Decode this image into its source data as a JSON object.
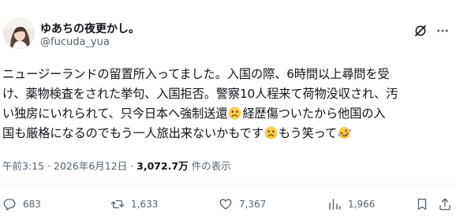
{
  "author": {
    "display_name": "ゆあちの夜更かし。",
    "handle": "@fucuda_yua"
  },
  "tweet": {
    "lines": [
      "ニュージーランドの留置所入ってました。入国の際、6時間以上尋問を受",
      "け、薬物検査をされた挙句、入国拒否。警察10人程来て荷物没収され、汚",
      "い独房にいれられて、只今日本へ強制送還",
      "経歴傷ついたから他国の入",
      "国も厳格になるのでもう一人旅出来ないかもです",
      "もう笑って"
    ]
  },
  "meta": {
    "time": "午前3:15",
    "separator": "·",
    "date": "2026年6月12日",
    "views_count": "3,072.7万",
    "views_label": "件の表示"
  },
  "actions": {
    "reply_count": "683",
    "retweet_count": "1,633",
    "like_count": "7,367",
    "views_count": "1,966"
  },
  "icons": {
    "reply": "reply-icon",
    "retweet": "retweet-icon",
    "like": "like-icon",
    "views": "views-icon",
    "bookmark": "bookmark-icon",
    "share": "share-icon",
    "grok": "grok-icon",
    "more": "more-icon"
  },
  "colors": {
    "text": "#0f1419",
    "secondary": "#536471",
    "divider": "#eff3f4",
    "emoji_face": "#ffcc4d"
  }
}
